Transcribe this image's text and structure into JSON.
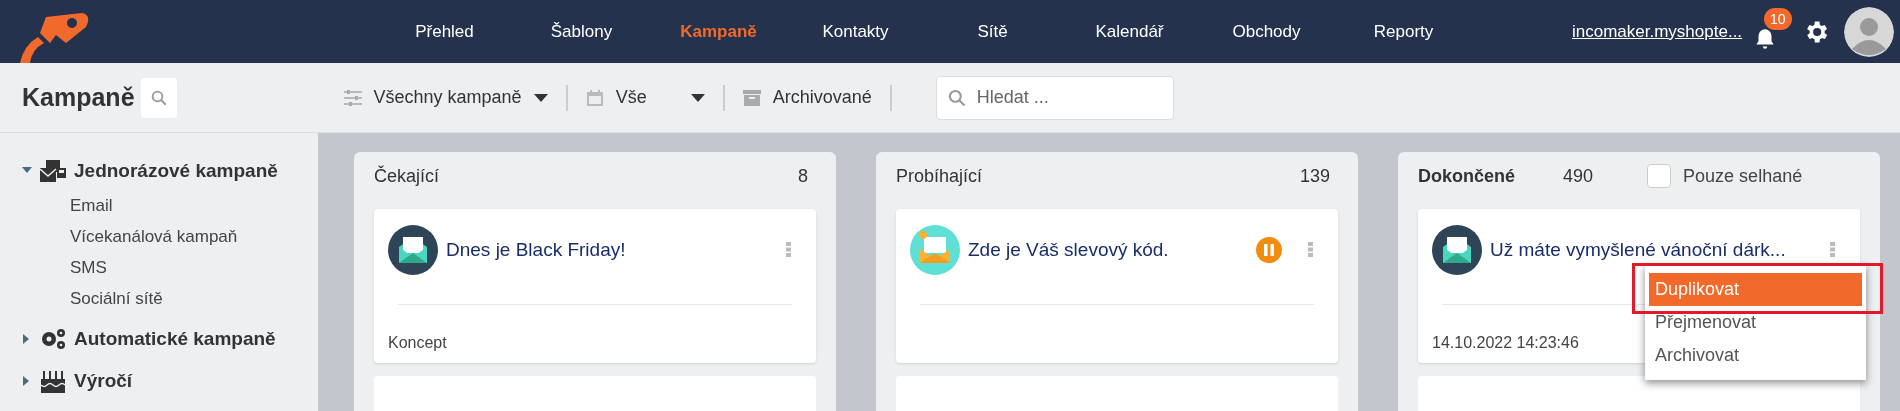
{
  "nav": {
    "items": [
      {
        "label": "Přehled",
        "selected": false
      },
      {
        "label": "Šablony",
        "selected": false
      },
      {
        "label": "Kampaně",
        "selected": true
      },
      {
        "label": "Kontakty",
        "selected": false
      },
      {
        "label": "Sítě",
        "selected": false
      },
      {
        "label": "Kalendář",
        "selected": false
      },
      {
        "label": "Obchody",
        "selected": false
      },
      {
        "label": "Reporty",
        "selected": false
      }
    ],
    "account_link": "incomaker.myshopte...",
    "notifications_badge": "10"
  },
  "toolbar": {
    "title": "Kampaně",
    "filters": [
      {
        "kind": "type",
        "label": "Všechny kampaně"
      },
      {
        "kind": "date",
        "label": "Vše"
      },
      {
        "kind": "archive",
        "label": "Archivované"
      }
    ],
    "search": {
      "placeholder": "Hledat ..."
    }
  },
  "sidebar": {
    "groups": [
      {
        "kind": "oneoff",
        "label": "Jednorázové kampaně",
        "expanded": true,
        "children": [
          {
            "label": "Email"
          },
          {
            "label": "Vícekanálová kampaň"
          },
          {
            "label": "SMS"
          },
          {
            "label": "Sociální sítě"
          }
        ]
      },
      {
        "kind": "automatic",
        "label": "Automatické kampaně",
        "expanded": false
      },
      {
        "kind": "anniversary",
        "label": "Výročí",
        "expanded": false
      }
    ]
  },
  "columns": [
    {
      "title": "Čekající",
      "emphasized": false,
      "count": "8",
      "cards": [
        {
          "kind": "email",
          "title": "Dnes je Black Friday!",
          "paused": false,
          "footer": "Koncept"
        }
      ]
    },
    {
      "title": "Probíhající",
      "emphasized": false,
      "count": "139",
      "cards": [
        {
          "kind": "promo",
          "title": "Zde je Váš slevový kód.",
          "paused": true
        }
      ]
    },
    {
      "title": "Dokončené",
      "emphasized": true,
      "count": "490",
      "filter": {
        "label": "Pouze selhané",
        "checked": false
      },
      "cards": [
        {
          "kind": "email",
          "title": "Už máte vymyšlené vánoční dárk...",
          "paused": false,
          "footer": "14.10.2022 14:23:46",
          "menu": [
            {
              "label": "Duplikovat",
              "selected": true,
              "highlighted": true
            },
            {
              "label": "Přejmenovat",
              "selected": false,
              "highlighted": false
            },
            {
              "label": "Archivovat",
              "selected": false,
              "highlighted": false
            }
          ]
        }
      ]
    }
  ]
}
